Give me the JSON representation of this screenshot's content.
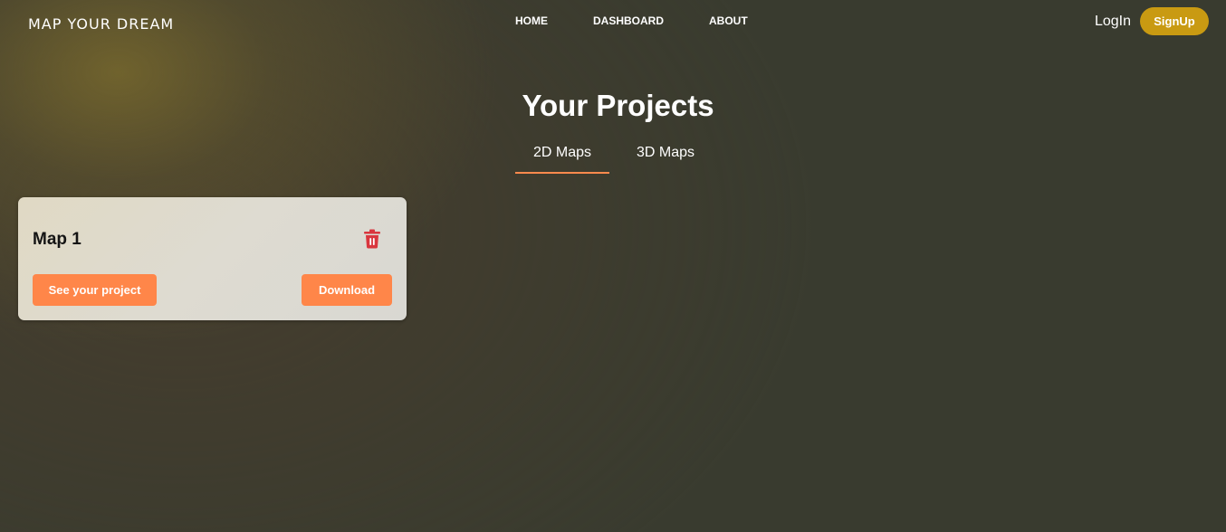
{
  "header": {
    "brand": "MAP YOUR DREAM",
    "nav": [
      {
        "label": "HOME"
      },
      {
        "label": "DASHBOARD"
      },
      {
        "label": "ABOUT"
      }
    ],
    "login_label": "LogIn",
    "signup_label": "SignUp"
  },
  "main": {
    "title": "Your Projects",
    "tabs": [
      {
        "label": "2D Maps",
        "active": true
      },
      {
        "label": "3D Maps",
        "active": false
      }
    ],
    "projects": [
      {
        "name": "Map 1",
        "see_label": "See your project",
        "download_label": "Download",
        "delete_icon": "trash-icon"
      }
    ]
  },
  "colors": {
    "accent_orange": "#ff8649",
    "signup_gold": "#c99a12",
    "delete_red": "#d9363e",
    "background": "#393b2f"
  }
}
